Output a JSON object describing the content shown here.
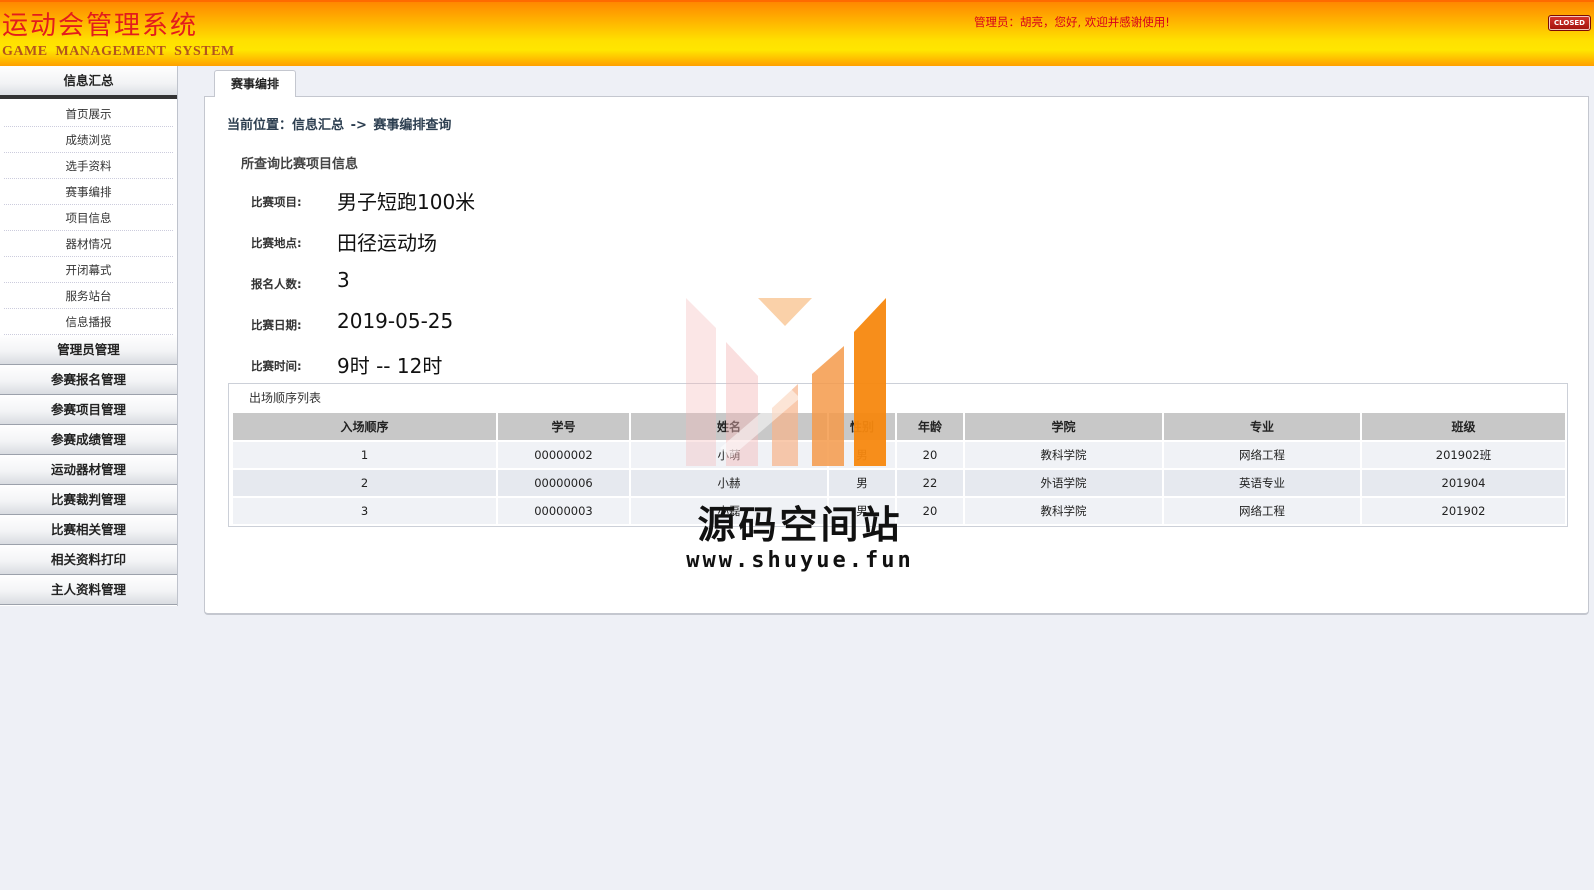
{
  "header": {
    "title_cn": "运动会管理系统",
    "title_en": "GAME MANAGEMENT SYSTEM",
    "greeting": "管理员：胡亮，您好, 欢迎并感谢使用!",
    "close_label": "CLOSED"
  },
  "sidebar": {
    "group_title": "信息汇总",
    "items": [
      "首页展示",
      "成绩浏览",
      "选手资料",
      "赛事编排",
      "项目信息",
      "器材情况",
      "开闭幕式",
      "服务站台",
      "信息播报"
    ],
    "sections": [
      "管理员管理",
      "参赛报名管理",
      "参赛项目管理",
      "参赛成绩管理",
      "运动器材管理",
      "比赛裁判管理",
      "比赛相关管理",
      "相关资料打印",
      "主人资料管理"
    ]
  },
  "main": {
    "tab_label": "赛事编排",
    "breadcrumb": {
      "prefix": "当前位置：",
      "level1": "信息汇总",
      "separator": "->",
      "level2": "赛事编排查询"
    },
    "section_title": "所查询比赛项目信息",
    "info": [
      {
        "label": "比赛项目:",
        "value": "男子短跑100米"
      },
      {
        "label": "比赛地点:",
        "value": "田径运动场"
      },
      {
        "label": "报名人数:",
        "value": "3"
      },
      {
        "label": "比赛日期:",
        "value": "2019-05-25"
      },
      {
        "label": "比赛时间:",
        "value": "9时 -- 12时"
      }
    ],
    "order_list": {
      "title": "出场顺序列表",
      "columns": [
        "入场顺序",
        "学号",
        "姓名",
        "性别",
        "年龄",
        "学院",
        "专业",
        "班级"
      ],
      "rows": [
        [
          "1",
          "00000002",
          "小萌",
          "男",
          "20",
          "教科学院",
          "网络工程",
          "201902班"
        ],
        [
          "2",
          "00000006",
          "小赫",
          "男",
          "22",
          "外语学院",
          "英语专业",
          "201904"
        ],
        [
          "3",
          "00000003",
          "小磊",
          "男",
          "20",
          "教科学院",
          "网络工程",
          "201902"
        ]
      ]
    }
  },
  "watermark": {
    "text_cn": "源码空间站",
    "url": "www.shuyue.fun"
  },
  "colors": {
    "header_top": "#ff8800",
    "header_mid": "#ffe000",
    "title_red": "#e31c1c",
    "greeting_red": "#d6001c",
    "watermark_orange": "#ff8c1a"
  }
}
